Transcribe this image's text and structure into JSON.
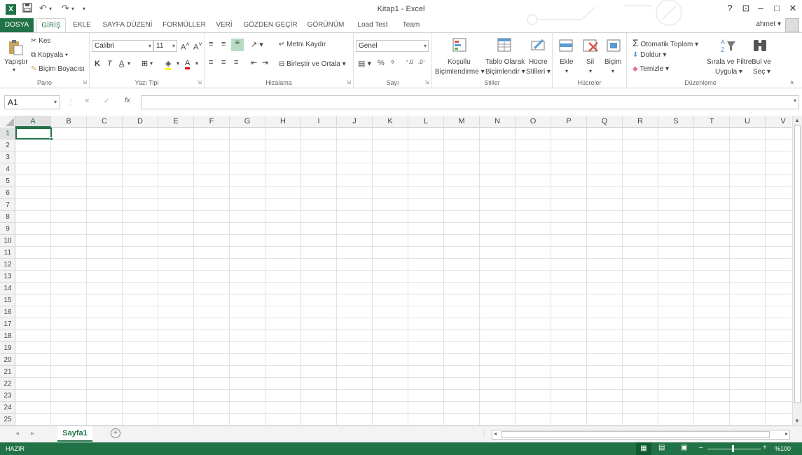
{
  "app": {
    "title": "Kitap1 - Excel",
    "logo": "X",
    "accent": "#217346"
  },
  "quick_access": {
    "save_icon": "save-icon",
    "undo_icon": "undo-icon",
    "redo_icon": "redo-icon"
  },
  "window_buttons": {
    "help": "?",
    "minimize": "–",
    "maximize": "□",
    "close": "✕"
  },
  "tabs": [
    {
      "label": "DOSYA"
    },
    {
      "label": "GİRİŞ"
    },
    {
      "label": "EKLE"
    },
    {
      "label": "SAYFA DÜZENİ"
    },
    {
      "label": "FORMÜLLER"
    },
    {
      "label": "VERİ"
    },
    {
      "label": "GÖZDEN GEÇİR"
    },
    {
      "label": "GÖRÜNÜM"
    },
    {
      "label": "Load Test"
    },
    {
      "label": "Team"
    }
  ],
  "user": {
    "name": "ahmet"
  },
  "ribbon": {
    "clipboard": {
      "label": "Pano",
      "paste": "Yapıştır",
      "cut": "Kes",
      "copy": "Kopyala",
      "format_painter": "Biçim Boyacısı"
    },
    "font": {
      "label": "Yazı Tipi",
      "font_name": "Calibri",
      "font_size": "11",
      "bold": "K",
      "italic": "T",
      "underline": "A"
    },
    "alignment": {
      "label": "Hizalama",
      "wrap_text": "Metni Kaydır",
      "merge_center": "Birleştir ve Ortala"
    },
    "number": {
      "label": "Sayı",
      "format": "Genel",
      "percent": "%",
      "comma": "⁹"
    },
    "styles": {
      "label": "Stiller",
      "conditional": [
        "Koşullu",
        "Biçimlendirme"
      ],
      "format_table": [
        "Tablo Olarak",
        "Biçimlendir"
      ],
      "cell_styles": [
        "Hücre",
        "Stilleri"
      ]
    },
    "cells": {
      "label": "Hücreler",
      "insert": "Ekle",
      "delete": "Sil",
      "format": "Biçim"
    },
    "editing": {
      "label": "Düzenleme",
      "autosum": "Otomatik Toplam",
      "fill": "Doldur",
      "clear": "Temizle",
      "sort_filter": [
        "Sırala ve Filtre",
        "Uygula"
      ],
      "find_select": [
        "Bul ve",
        "Seç"
      ]
    }
  },
  "formula_bar": {
    "name_box": "A1",
    "cancel": "✕",
    "enter": "✓",
    "fx": "fx",
    "value": ""
  },
  "grid": {
    "columns": [
      "A",
      "B",
      "C",
      "D",
      "E",
      "F",
      "G",
      "H",
      "I",
      "J",
      "K",
      "L",
      "M",
      "N",
      "O",
      "P",
      "Q",
      "R",
      "S",
      "T",
      "U",
      "V"
    ],
    "rows": [
      "1",
      "2",
      "3",
      "4",
      "5",
      "6",
      "7",
      "8",
      "9",
      "10",
      "11",
      "12",
      "13",
      "14",
      "15",
      "16",
      "17",
      "18",
      "19",
      "20",
      "21",
      "22",
      "23",
      "24",
      "25"
    ],
    "active_cell": "A1"
  },
  "sheets": {
    "tabs": [
      {
        "label": "Sayfa1"
      }
    ],
    "add": "+"
  },
  "status": {
    "ready": "HAZIR",
    "zoom": "%100"
  }
}
